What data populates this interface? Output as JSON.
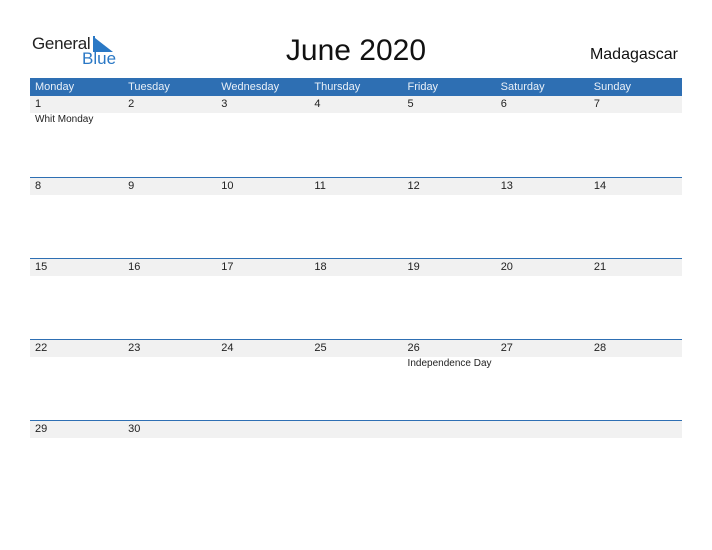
{
  "logo": {
    "word1": "General",
    "word2": "Blue"
  },
  "title": "June 2020",
  "country": "Madagascar",
  "colors": {
    "accent": "#2e6fb3",
    "strip": "#f1f1f1"
  },
  "weekdays": [
    "Monday",
    "Tuesday",
    "Wednesday",
    "Thursday",
    "Friday",
    "Saturday",
    "Sunday"
  ],
  "weeks": [
    [
      {
        "d": "1",
        "e": "Whit Monday"
      },
      {
        "d": "2",
        "e": ""
      },
      {
        "d": "3",
        "e": ""
      },
      {
        "d": "4",
        "e": ""
      },
      {
        "d": "5",
        "e": ""
      },
      {
        "d": "6",
        "e": ""
      },
      {
        "d": "7",
        "e": ""
      }
    ],
    [
      {
        "d": "8",
        "e": ""
      },
      {
        "d": "9",
        "e": ""
      },
      {
        "d": "10",
        "e": ""
      },
      {
        "d": "11",
        "e": ""
      },
      {
        "d": "12",
        "e": ""
      },
      {
        "d": "13",
        "e": ""
      },
      {
        "d": "14",
        "e": ""
      }
    ],
    [
      {
        "d": "15",
        "e": ""
      },
      {
        "d": "16",
        "e": ""
      },
      {
        "d": "17",
        "e": ""
      },
      {
        "d": "18",
        "e": ""
      },
      {
        "d": "19",
        "e": ""
      },
      {
        "d": "20",
        "e": ""
      },
      {
        "d": "21",
        "e": ""
      }
    ],
    [
      {
        "d": "22",
        "e": ""
      },
      {
        "d": "23",
        "e": ""
      },
      {
        "d": "24",
        "e": ""
      },
      {
        "d": "25",
        "e": ""
      },
      {
        "d": "26",
        "e": "Independence Day"
      },
      {
        "d": "27",
        "e": ""
      },
      {
        "d": "28",
        "e": ""
      }
    ],
    [
      {
        "d": "29",
        "e": ""
      },
      {
        "d": "30",
        "e": ""
      },
      {
        "d": "",
        "e": ""
      },
      {
        "d": "",
        "e": ""
      },
      {
        "d": "",
        "e": ""
      },
      {
        "d": "",
        "e": ""
      },
      {
        "d": "",
        "e": ""
      }
    ]
  ]
}
